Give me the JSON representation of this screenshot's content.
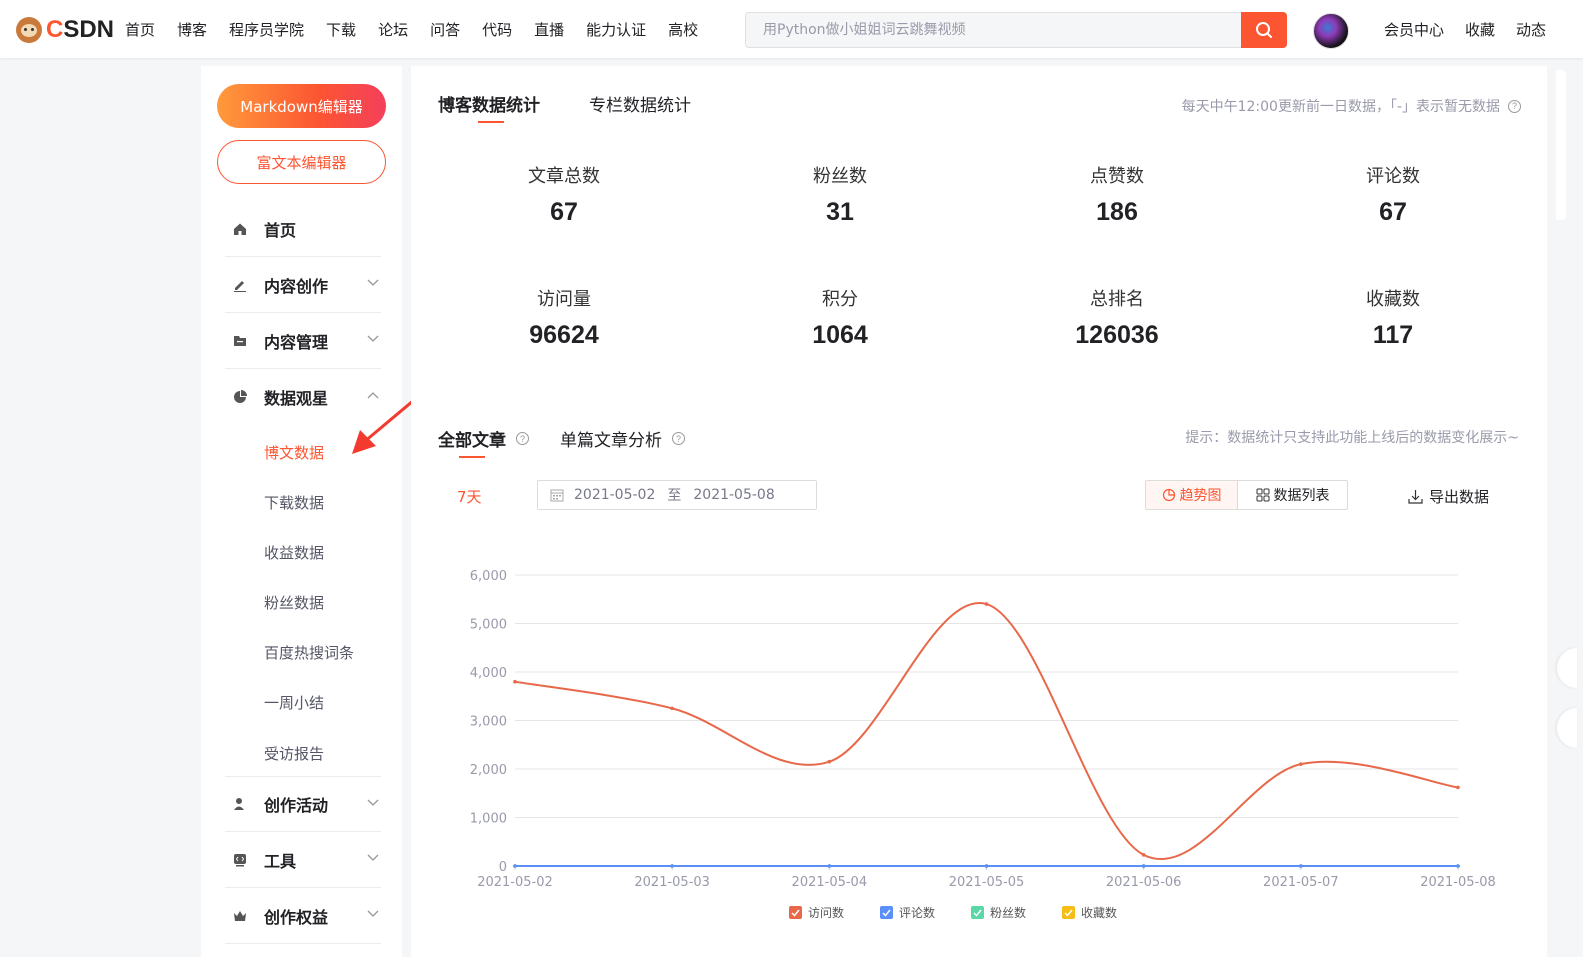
{
  "header": {
    "logo_text": "CSDN",
    "nav": [
      "首页",
      "博客",
      "程序员学院",
      "下载",
      "论坛",
      "问答",
      "代码",
      "直播",
      "能力认证",
      "高校"
    ],
    "search_placeholder": "用Python做小姐姐词云跳舞视频",
    "right_nav": [
      "会员中心",
      "收藏",
      "动态"
    ]
  },
  "sidebar": {
    "markdown_button": "Markdown编辑器",
    "richtext_button": "富文本编辑器",
    "menu": [
      {
        "label": "首页",
        "icon": "home-icon"
      },
      {
        "label": "内容创作",
        "icon": "pen-icon"
      },
      {
        "label": "内容管理",
        "icon": "folder-icon"
      },
      {
        "label": "数据观星",
        "icon": "pie-icon"
      }
    ],
    "sub_items": [
      "博文数据",
      "下载数据",
      "收益数据",
      "粉丝数据",
      "百度热搜词条",
      "一周小结",
      "受访报告"
    ],
    "menu_bottom": [
      {
        "label": "创作活动",
        "icon": "user-icon"
      },
      {
        "label": "工具",
        "icon": "code-icon"
      },
      {
        "label": "创作权益",
        "icon": "crown-icon"
      }
    ]
  },
  "main": {
    "tab_blog": "博客数据统计",
    "tab_column": "专栏数据统计",
    "update_note": "每天中午12:00更新前一日数据，「-」表示暂无数据",
    "stats": [
      {
        "label": "文章总数",
        "value": "67"
      },
      {
        "label": "粉丝数",
        "value": "31"
      },
      {
        "label": "点赞数",
        "value": "186"
      },
      {
        "label": "评论数",
        "value": "67"
      },
      {
        "label": "访问量",
        "value": "96624"
      },
      {
        "label": "积分",
        "value": "1064"
      },
      {
        "label": "总排名",
        "value": "126036"
      },
      {
        "label": "收藏数",
        "value": "117"
      }
    ],
    "tab_all_articles": "全部文章",
    "tab_single_article": "单篇文章分析",
    "hint": "提示：数据统计只支持此功能上线后的数据变化展示~",
    "range_label": "7天",
    "date_start": "2021-05-02",
    "date_sep": "至",
    "date_end": "2021-05-08",
    "trend_button": "趋势图",
    "list_button": "数据列表",
    "export_button": "导出数据"
  },
  "chart_data": {
    "type": "line",
    "x": [
      "2021-05-02",
      "2021-05-03",
      "2021-05-04",
      "2021-05-05",
      "2021-05-06",
      "2021-05-07",
      "2021-05-08"
    ],
    "y_ticks": [
      "6,000",
      "5,000",
      "4,000",
      "3,000",
      "2,000",
      "1,000",
      "0"
    ],
    "ylim": [
      0,
      6000
    ],
    "grid": true,
    "legend_position": "bottom",
    "series": [
      {
        "name": "访问数",
        "color": "#e8684a",
        "values": [
          3800,
          3250,
          2150,
          5400,
          230,
          2100,
          1620
        ]
      },
      {
        "name": "评论数",
        "color": "#5b8ff9",
        "values": [
          0,
          0,
          0,
          0,
          0,
          0,
          0
        ]
      },
      {
        "name": "粉丝数",
        "color": "#5ad8a6",
        "values": [
          0,
          0,
          0,
          0,
          0,
          0,
          0
        ]
      },
      {
        "name": "收藏数",
        "color": "#f6bd16",
        "values": [
          0,
          0,
          0,
          0,
          0,
          0,
          0
        ]
      }
    ]
  }
}
